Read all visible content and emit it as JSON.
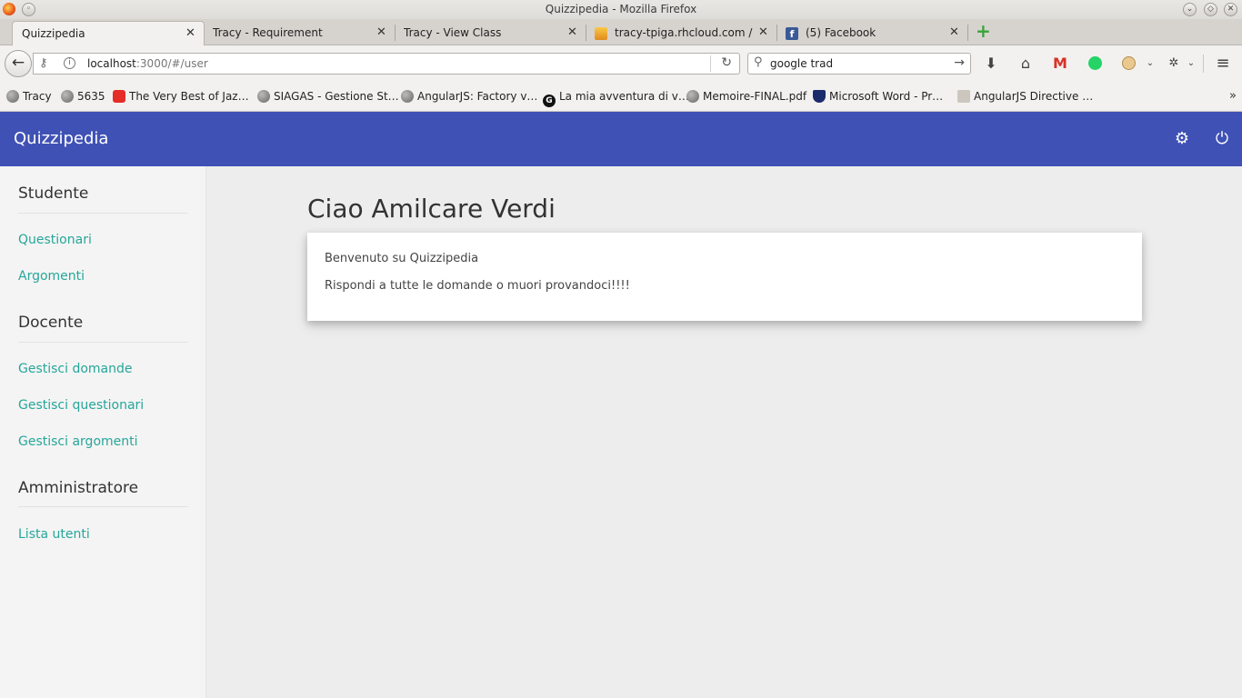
{
  "window": {
    "title": "Quizzipedia - Mozilla Firefox"
  },
  "tabs": [
    {
      "label": "Quizzipedia"
    },
    {
      "label": "Tracy - Requirement"
    },
    {
      "label": "Tracy - View Class"
    },
    {
      "label": "tracy-tpiga.rhcloud.com /…"
    },
    {
      "label": "(5) Facebook"
    }
  ],
  "tab_close_glyph": "✕",
  "new_tab_glyph": "+",
  "address": {
    "host": "localhost",
    "rest": ":3000/#/user"
  },
  "search": {
    "value": "google trad"
  },
  "bookmarks": [
    {
      "label": "Tracy"
    },
    {
      "label": "5635"
    },
    {
      "label": "The Very Best of Jaz…"
    },
    {
      "label": "SIAGAS - Gestione St…"
    },
    {
      "label": "AngularJS: Factory v…"
    },
    {
      "label": "La mia avventura di v…"
    },
    {
      "label": "Memoire-FINAL.pdf"
    },
    {
      "label": "Microsoft Word - Pr…"
    },
    {
      "label": "AngularJS Directive …"
    }
  ],
  "icons": {
    "back": "back-arrow-icon",
    "reload": "reload-icon",
    "download": "download-icon",
    "home": "home-icon",
    "gmail": "gmail-icon",
    "whatsapp": "whatsapp-icon",
    "menu": "hamburger-menu-icon",
    "settings": "gear-icon",
    "power": "power-icon"
  },
  "colors": {
    "header": "#3f51b5",
    "link": "#26a69a"
  },
  "app": {
    "brand": "Quizzipedia",
    "sidebar": {
      "sections": [
        {
          "title": "Studente",
          "links": [
            "Questionari",
            "Argomenti"
          ]
        },
        {
          "title": "Docente",
          "links": [
            "Gestisci domande",
            "Gestisci questionari",
            "Gestisci argomenti"
          ]
        },
        {
          "title": "Amministratore",
          "links": [
            "Lista utenti"
          ]
        }
      ]
    },
    "main": {
      "title": "Ciao Amilcare Verdi",
      "card_lines": [
        "Benvenuto su Quizzipedia",
        "Rispondi a tutte le domande o muori provandoci!!!!"
      ]
    }
  }
}
